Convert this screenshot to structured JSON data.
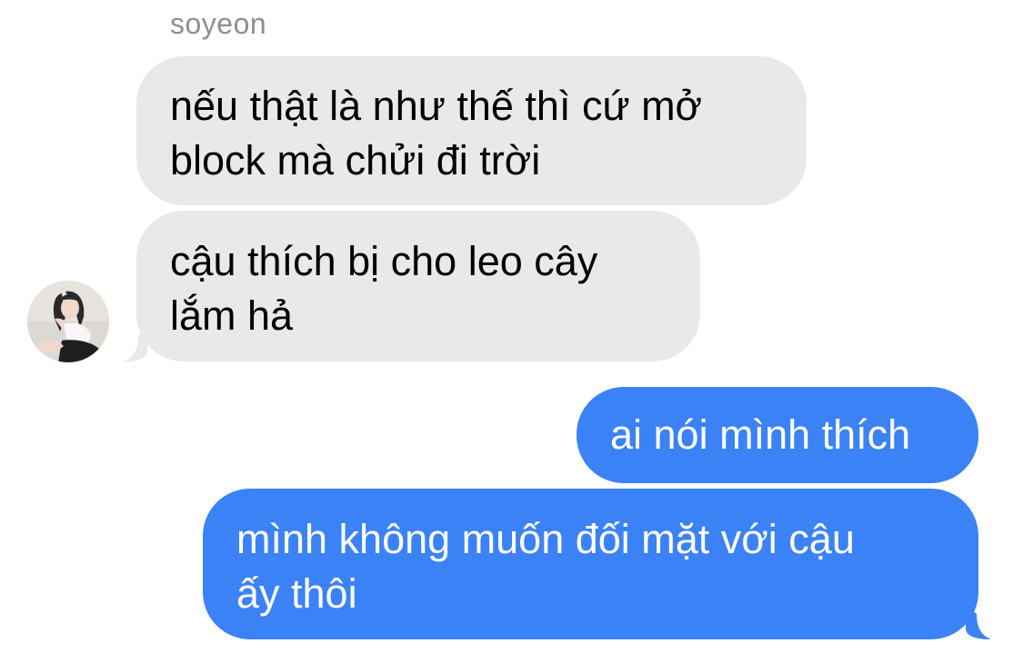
{
  "conversation": {
    "sender_name": "soyeon",
    "messages": [
      {
        "direction": "incoming",
        "text": "nếu thật là như thế thì cứ mở\nblock mà chửi đi trời"
      },
      {
        "direction": "incoming",
        "text": "cậu thích bị cho leo cây\nlắm hả"
      },
      {
        "direction": "outgoing",
        "text": "ai nói mình thích"
      },
      {
        "direction": "outgoing",
        "text": "mình không muốn đối mặt với cậu\nấy thôi"
      }
    ]
  },
  "colors": {
    "incoming_bubble": "#e9e9eb",
    "outgoing_bubble": "#3b82f6",
    "sender_name": "#8e8e93",
    "background": "#ffffff"
  }
}
